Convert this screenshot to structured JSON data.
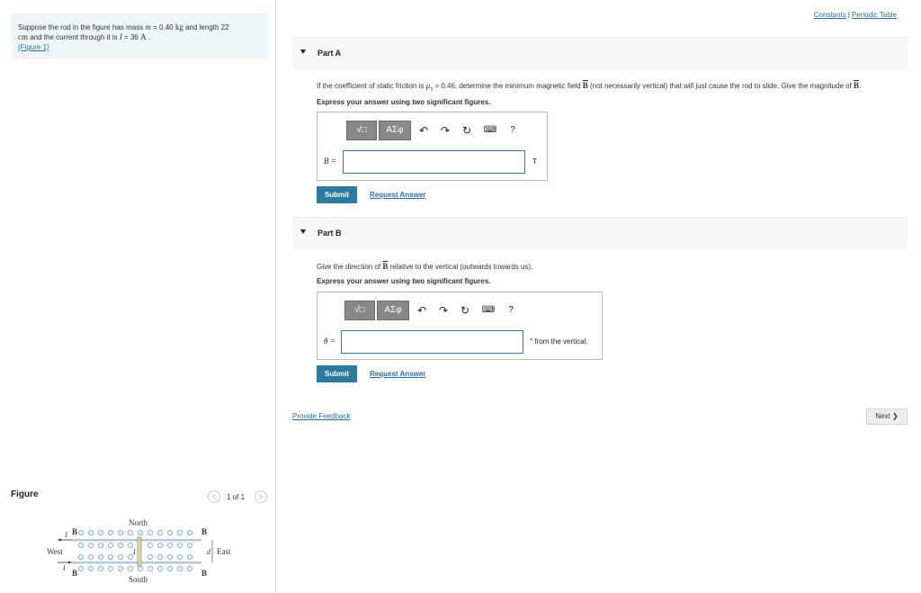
{
  "problem": {
    "line1_pre": "Suppose the rod in the figure has mass ",
    "mass_var": "m",
    "mass_val": " = 0.40 ",
    "mass_unit": "kg",
    "line1_post": " and length 22",
    "len_unit": "cm",
    "line2_mid": " and the current through it is ",
    "cur_var": "I",
    "cur_val": " = 36 ",
    "cur_unit": "A",
    "line2_end": " .",
    "figure_link": "(Figure 1)"
  },
  "figure_panel": {
    "title": "Figure",
    "counter": "1 of 1",
    "prev": "<",
    "next": ">",
    "labels": {
      "north": "North",
      "south": "South",
      "west": "West",
      "east": "East",
      "b": "B",
      "i": "I",
      "d": "d"
    }
  },
  "top_links": {
    "constants": "Constants",
    "separator": "|",
    "periodic": "Periodic Table"
  },
  "part_a": {
    "title": "Part A",
    "question_pre": "If the coefficient of static friction is ",
    "mu": "μ",
    "mu_sub": "s",
    "question_mid": " = 0.46, determine the minimum magnetic field ",
    "b": "B",
    "question_post": " (not necessarily vertical) that will just cause the rod to slide. Give the magnitude of ",
    "question_end": ".",
    "instruction": "Express your answer using two significant figures.",
    "var_label": "B =",
    "unit": "T",
    "submit": "Submit",
    "request": "Request Answer"
  },
  "part_b": {
    "title": "Part B",
    "question_pre": "Give the direction of ",
    "b": "B",
    "question_post": " relative to the vertical (outwards towards us).",
    "instruction": "Express your answer using two significant figures.",
    "var_label": "θ =",
    "unit": "° from the vertical.",
    "submit": "Submit",
    "request": "Request Answer"
  },
  "toolbar": {
    "templates": "√□",
    "symbols": "ΑΣφ",
    "undo": "↶",
    "redo": "↷",
    "reset": "↻",
    "keyboard": "⌨",
    "help": "?"
  },
  "footer": {
    "feedback": "Provide Feedback",
    "next": "Next ❯"
  },
  "colors": {
    "accent": "#2c7a9e",
    "link": "#2b6ea8",
    "problem_bg": "#edf5f8"
  }
}
